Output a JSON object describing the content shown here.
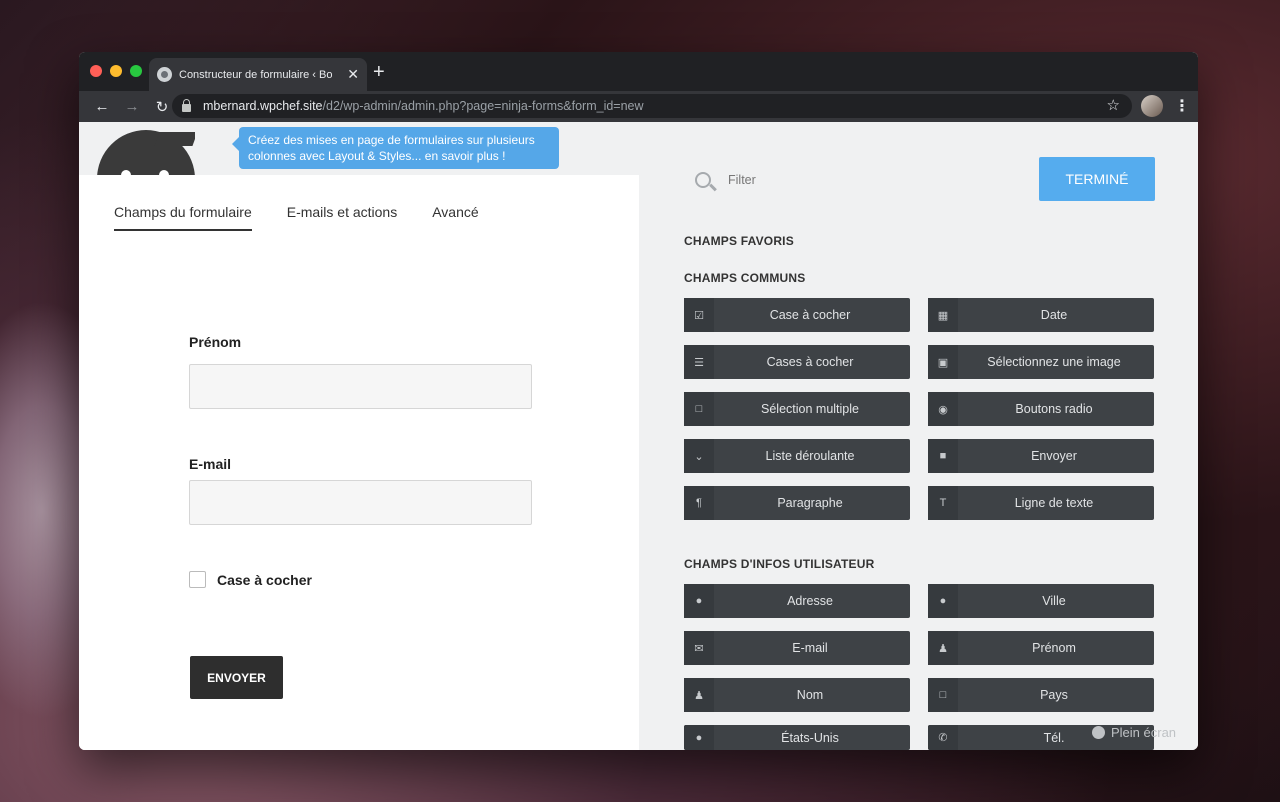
{
  "browser": {
    "tab_title": "Constructeur de formulaire ‹ Bo",
    "url_host": "mbernard.wpchef.site",
    "url_path": "/d2/wp-admin/admin.php?page=ninja-forms&form_id=new"
  },
  "promo": {
    "text": "Créez des mises en page de formulaires sur plusieurs colonnes avec Layout & Styles... en savoir plus !"
  },
  "builder_tabs": [
    {
      "label": "Champs du formulaire",
      "active": true
    },
    {
      "label": "E-mails et actions",
      "active": false
    },
    {
      "label": "Avancé",
      "active": false
    }
  ],
  "form": {
    "first_name_label": "Prénom",
    "email_label": "E-mail",
    "checkbox_label": "Case à cocher",
    "submit_label": "ENVOYER"
  },
  "sidebar": {
    "filter_placeholder": "Filter",
    "done_label": "TERMINÉ",
    "favorites_heading": "CHAMPS FAVORIS",
    "common_heading": "CHAMPS COMMUNS",
    "common_fields": [
      {
        "label": "Case à cocher",
        "icon": "checkbox-icon"
      },
      {
        "label": "Date",
        "icon": "calendar-icon"
      },
      {
        "label": "Cases à cocher",
        "icon": "list-icon"
      },
      {
        "label": "Sélectionnez une image",
        "icon": "image-icon"
      },
      {
        "label": "Sélection multiple",
        "icon": "square-icon"
      },
      {
        "label": "Boutons radio",
        "icon": "radio-icon"
      },
      {
        "label": "Liste déroulante",
        "icon": "chevron-down-icon"
      },
      {
        "label": "Envoyer",
        "icon": "square-filled-icon"
      },
      {
        "label": "Paragraphe",
        "icon": "paragraph-icon"
      },
      {
        "label": "Ligne de texte",
        "icon": "text-icon"
      }
    ],
    "user_info_heading": "CHAMPS D'INFOS UTILISATEUR",
    "user_fields": [
      {
        "label": "Adresse",
        "icon": "map-pin-icon"
      },
      {
        "label": "Ville",
        "icon": "map-pin-icon"
      },
      {
        "label": "E-mail",
        "icon": "envelope-icon"
      },
      {
        "label": "Prénom",
        "icon": "user-icon"
      },
      {
        "label": "Nom",
        "icon": "user-icon"
      },
      {
        "label": "Pays",
        "icon": "square-icon"
      },
      {
        "label": "États-Unis",
        "icon": "map-pin-icon"
      },
      {
        "label": "Tél.",
        "icon": "phone-icon"
      }
    ],
    "fullscreen_label": "Plein écran"
  }
}
